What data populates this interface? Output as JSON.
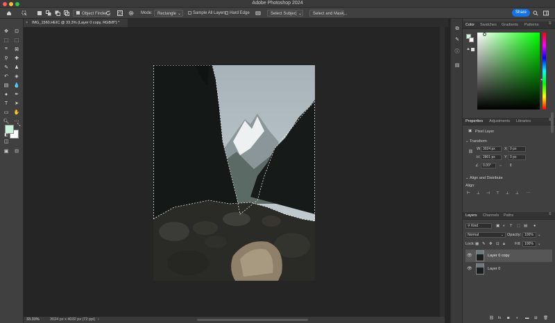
{
  "window": {
    "title": "Adobe Photoshop 2024"
  },
  "options_bar": {
    "object_finder_label": "Object Finder",
    "mode_label": "Mode:",
    "mode_value": "Rectangle",
    "sample_all_layers_label": "Sample All Layers",
    "hard_edge_label": "Hard Edge",
    "select_subject_label": "Select Subject",
    "select_and_mask_label": "Select and Mask...",
    "share_label": "Share"
  },
  "document": {
    "tab_title": "IMG_1560.HEIC @ 33.3% (Layer 0 copy, RGB/8*) *"
  },
  "status": {
    "zoom": "33.33%",
    "doc_info": "3024 px x 4032 px (72 ppi)"
  },
  "panels": {
    "color_tabs": [
      "Color",
      "Swatches",
      "Gradients",
      "Patterns"
    ],
    "properties_tabs": [
      "Properties",
      "Adjustments",
      "Libraries"
    ],
    "layer_type": "Pixel Layer",
    "transform": {
      "section_label": "Transform",
      "w_label": "W",
      "w_value": "3024 px",
      "x_label": "X",
      "x_value": "0 px",
      "h_label": "H",
      "h_value": "2801 px",
      "y_label": "Y",
      "y_value": "0 px",
      "angle_value": "0.00°"
    },
    "align": {
      "section_label": "Align and Distribute",
      "align_label": "Align:"
    },
    "layers_tabs": [
      "Layers",
      "Channels",
      "Paths"
    ],
    "layers_filter": "Kind",
    "blend_mode": "Normal",
    "opacity_label": "Opacity:",
    "opacity_value": "100%",
    "lock_label": "Lock:",
    "fill_label": "Fill:",
    "fill_value": "100%",
    "layers": [
      {
        "name": "Layer 0 copy",
        "selected": true
      },
      {
        "name": "Layer 0",
        "selected": false
      }
    ]
  },
  "colors": {
    "foreground": "#c8f5dc",
    "background": "#ffffff",
    "accent": "#1473e6"
  }
}
